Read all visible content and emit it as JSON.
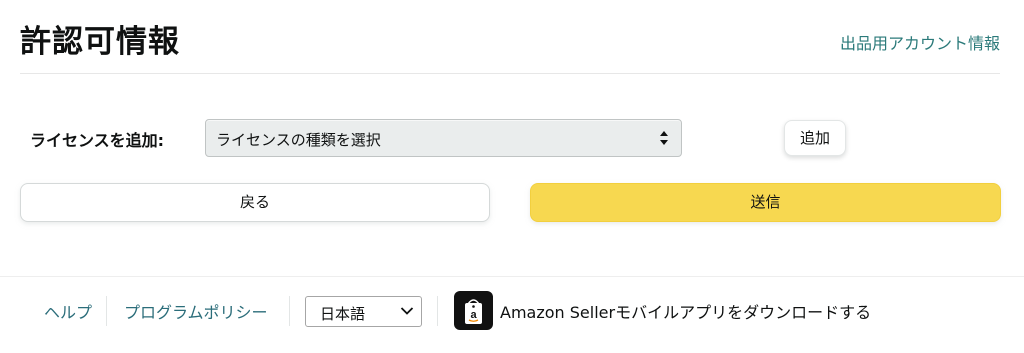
{
  "header": {
    "title": "許認可情報",
    "account_link": "出品用アカウント情報"
  },
  "license_form": {
    "label": "ライセンスを追加:",
    "select_value": "ライセンスの種類を選択",
    "add_button": "追加"
  },
  "actions": {
    "back_label": "戻る",
    "submit_label": "送信"
  },
  "footer": {
    "help_label": "ヘルプ",
    "policy_label": "プログラムポリシー",
    "language_value": "日本語",
    "app_download_label": "Amazon Sellerモバイルアプリをダウンロードする"
  },
  "colors": {
    "link": "#2b7a7a",
    "submit_bg": "#f7d850",
    "select_bg": "#eaeded"
  },
  "icons": {
    "select_arrows": "up-down-arrows-icon",
    "lang_chevron": "chevron-down-icon",
    "app": "amazon-seller-app-icon"
  }
}
